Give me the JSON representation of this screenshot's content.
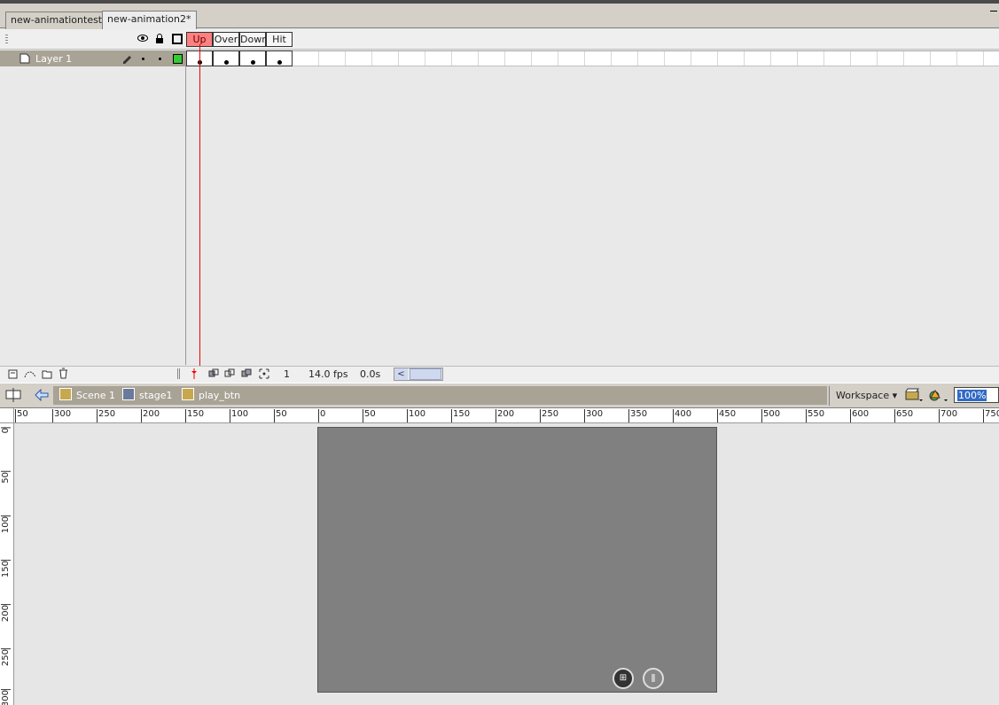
{
  "document_tabs": [
    {
      "label": "new-animationtest*",
      "active": false
    },
    {
      "label": "new-animation2*",
      "active": true
    }
  ],
  "timeline": {
    "frame_labels": [
      "Up",
      "Over",
      "Down",
      "Hit"
    ],
    "layers": [
      {
        "name": "Layer 1"
      }
    ],
    "footer": {
      "current_frame": "1",
      "fps": "14.0 fps",
      "elapsed": "0.0s"
    }
  },
  "edit_bar": {
    "breadcrumbs": [
      {
        "label": "Scene 1",
        "icon": "clapper-icon"
      },
      {
        "label": "stage1",
        "icon": "movieclip-icon"
      },
      {
        "label": "play_btn",
        "icon": "button-icon"
      }
    ],
    "workspace_label": "Workspace",
    "zoom_value": "100%"
  },
  "rulers": {
    "horizontal": [
      "50",
      "300",
      "250",
      "200",
      "150",
      "100",
      "50",
      "0",
      "50",
      "100",
      "150",
      "200",
      "250",
      "300",
      "350",
      "400",
      "450",
      "500",
      "550",
      "600",
      "650",
      "700",
      "750"
    ],
    "vertical": [
      "0",
      "50",
      "100",
      "150",
      "200",
      "250",
      "300"
    ]
  },
  "stage": {
    "background": "#808080",
    "controls": [
      {
        "name": "fullscreen-button",
        "glyph": "⊞"
      },
      {
        "name": "pause-button",
        "glyph": "ǁ"
      }
    ]
  },
  "colors": {
    "playhead": "#ee0000",
    "active_frame_label": "#ff8080",
    "layer_highlight": "#a8a395",
    "outline_color": "#33cc33"
  }
}
